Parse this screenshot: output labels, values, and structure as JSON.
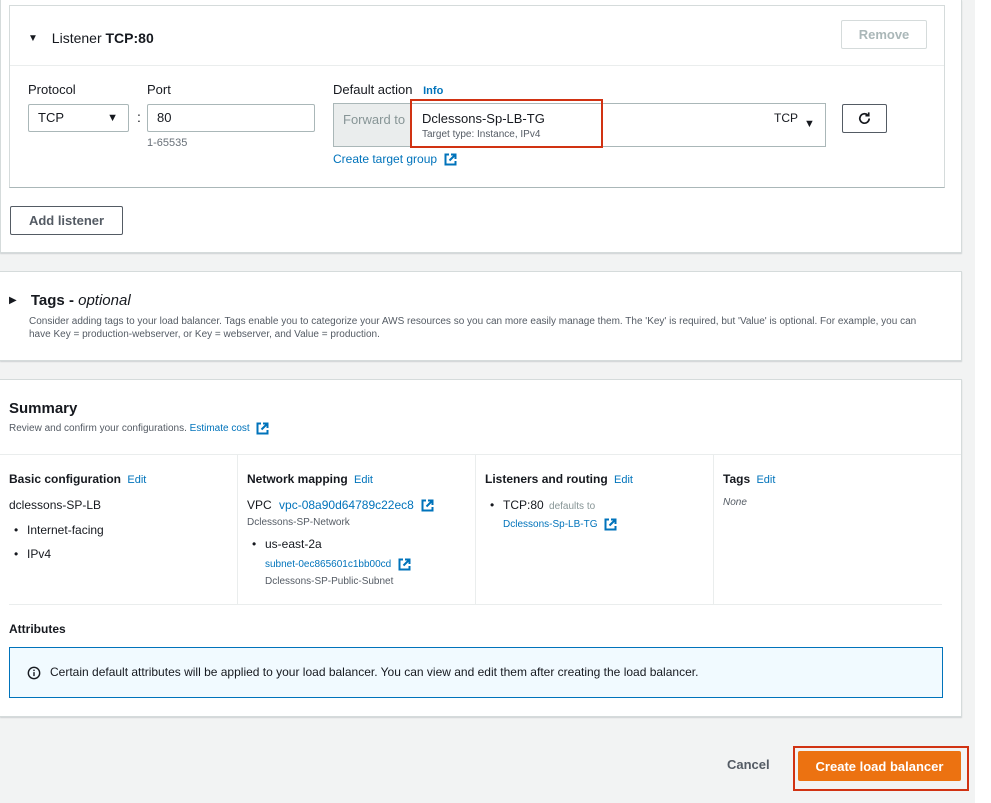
{
  "listener": {
    "caret": "▼",
    "title_prefix": "Listener",
    "title_value": "TCP:80",
    "remove_label": "Remove",
    "protocol_label": "Protocol",
    "protocol_value": "TCP",
    "port_label": "Port",
    "port_value": "80",
    "port_hint": "1-65535",
    "colon": ":",
    "default_action_label": "Default action",
    "info_link": "Info",
    "forward_to_label": "Forward to",
    "target_group_name": "Dclessons-Sp-LB-TG",
    "target_type": "Target type: Instance, IPv4",
    "target_protocol": "TCP",
    "create_target_group_link": "Create target group",
    "add_listener_label": "Add listener"
  },
  "tags": {
    "caret": "▶",
    "title": "Tags -",
    "title_optional": "optional",
    "description": "Consider adding tags to your load balancer. Tags enable you to categorize your AWS resources so you can more easily manage them. The 'Key' is required, but 'Value' is optional. For example, you can have Key = production-webserver, or Key = webserver, and Value = production."
  },
  "summary": {
    "title": "Summary",
    "description": "Review and confirm your configurations.",
    "estimate_cost_link": "Estimate cost",
    "basic": {
      "title": "Basic configuration",
      "edit": "Edit",
      "name": "dclessons-SP-LB",
      "scheme": "Internet-facing",
      "ip_type": "IPv4"
    },
    "network": {
      "title": "Network mapping",
      "edit": "Edit",
      "vpc_label": "VPC",
      "vpc_id": "vpc-08a90d64789c22ec8",
      "vpc_name": "Dclessons-SP-Network",
      "az": "us-east-2a",
      "subnet_id": "subnet-0ec865601c1bb00cd",
      "subnet_name": "Dclessons-SP-Public-Subnet"
    },
    "listeners": {
      "title": "Listeners and routing",
      "edit": "Edit",
      "listener": "TCP:80",
      "defaults_to": "defaults to",
      "target_group": "Dclessons-Sp-LB-TG"
    },
    "tags": {
      "title": "Tags",
      "edit": "Edit",
      "value": "None"
    },
    "attributes_title": "Attributes",
    "attributes_info": "Certain default attributes will be applied to your load balancer. You can view and edit them after creating the load balancer."
  },
  "footer": {
    "cancel_label": "Cancel",
    "create_label": "Create load balancer"
  },
  "colors": {
    "link": "#0073bb",
    "primary_button": "#ec7211",
    "highlight": "#d13212",
    "info_border": "#0073bb",
    "info_background": "#f1faff"
  }
}
